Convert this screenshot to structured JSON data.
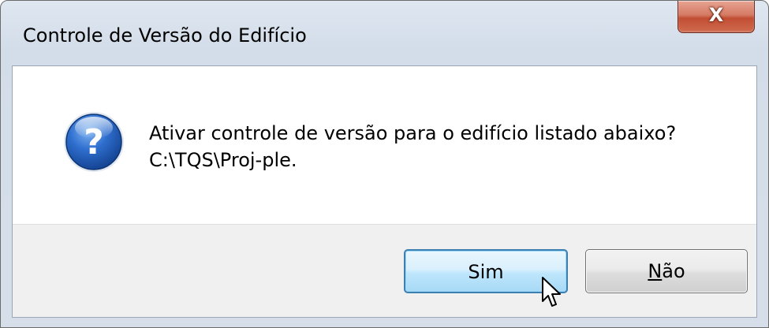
{
  "dialog": {
    "title": "Controle de Versão do Edifício",
    "close_label": "X",
    "icon": "question-icon",
    "message_line1": "Ativar controle de versão para o edifício listado abaixo?",
    "message_line2": "C:\\TQS\\Proj-ple.",
    "buttons": {
      "yes_label": "Sim",
      "no_mnemonic": "N",
      "no_rest": "ão"
    }
  },
  "cursor": {
    "icon": "mouse-pointer-icon"
  },
  "colors": {
    "close_button": "#c24e33",
    "icon_blue": "#1f5cb0",
    "default_button_border": "#3c7fb1"
  }
}
